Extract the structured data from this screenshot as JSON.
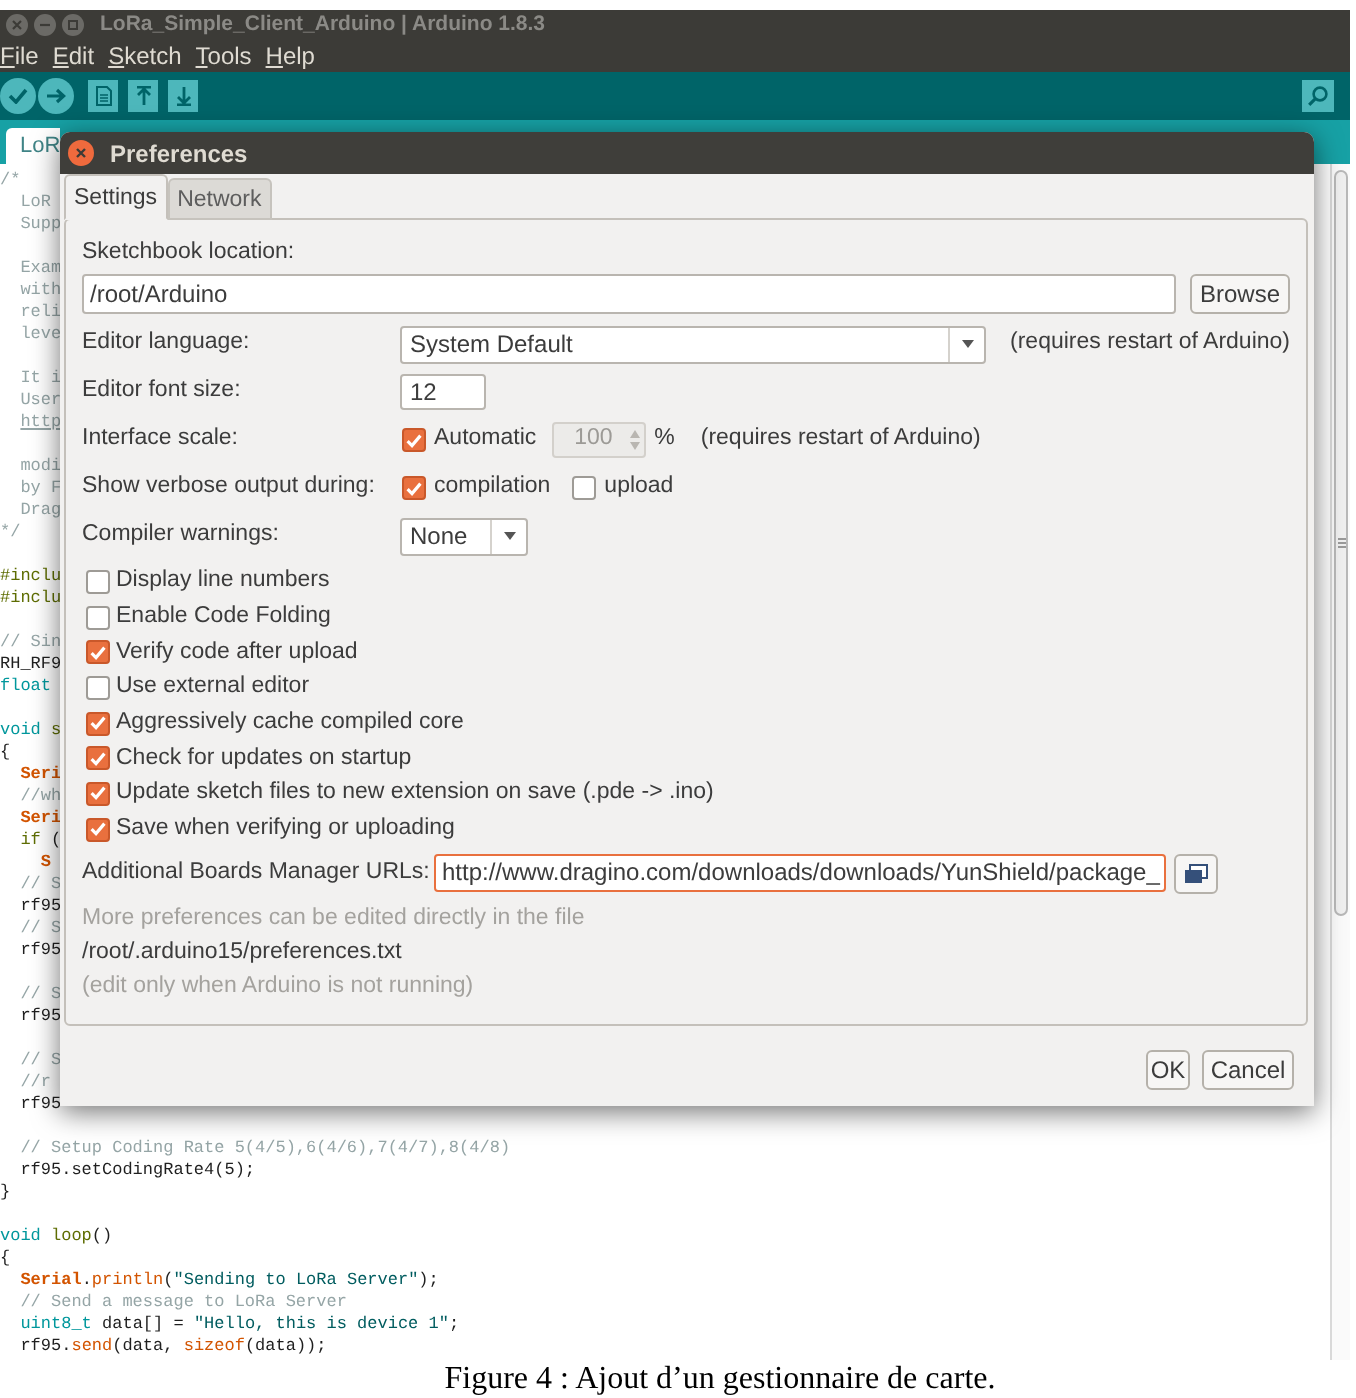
{
  "window": {
    "title": "LoRa_Simple_Client_Arduino | Arduino 1.8.3"
  },
  "menu": [
    "File",
    "Edit",
    "Sketch",
    "Tools",
    "Help"
  ],
  "editor_tabs": [
    {
      "label": "LoR",
      "selected": true
    }
  ],
  "code_lines": [
    {
      "parts": [
        {
          "text": "/*",
          "kind": "comment"
        }
      ]
    },
    {
      "parts": [
        {
          "text": "  LoR",
          "kind": "comment"
        }
      ]
    },
    {
      "parts": [
        {
          "text": "  Supp",
          "kind": "comment"
        }
      ]
    },
    {
      "blank_before": true,
      "parts": [
        {
          "text": "  Exam",
          "kind": "comment"
        }
      ]
    },
    {
      "parts": [
        {
          "text": "  with",
          "kind": "comment"
        }
      ]
    },
    {
      "parts": [
        {
          "text": "  reli",
          "kind": "comment"
        }
      ]
    },
    {
      "parts": [
        {
          "text": "  leve",
          "kind": "comment"
        }
      ]
    },
    {
      "blank_before": true,
      "parts": [
        {
          "text": "  It i",
          "kind": "comment"
        }
      ]
    },
    {
      "parts": [
        {
          "text": "  User",
          "kind": "comment"
        }
      ]
    },
    {
      "parts": [
        {
          "text": "  http",
          "kind": "link"
        }
      ]
    },
    {
      "blank_before": true,
      "parts": [
        {
          "text": "  modi",
          "kind": "comment"
        }
      ]
    },
    {
      "parts": [
        {
          "text": "  by F",
          "kind": "comment"
        }
      ]
    },
    {
      "parts": [
        {
          "text": "  Drag",
          "kind": "comment"
        }
      ]
    },
    {
      "parts": [
        {
          "text": "*/",
          "kind": "comment"
        }
      ]
    },
    {
      "blank_before": true,
      "parts": [
        {
          "text": "#inclu",
          "kind": "preprocessor"
        }
      ]
    },
    {
      "parts": [
        {
          "text": "#inclu",
          "kind": "preprocessor"
        }
      ]
    },
    {
      "blank_before": true,
      "parts": [
        {
          "text": "// Sin",
          "kind": "comment"
        }
      ]
    },
    {
      "parts": [
        {
          "text": "RH_RF9",
          "kind": "plain"
        }
      ]
    },
    {
      "parts": [
        {
          "text": "float",
          "kind": "type"
        }
      ]
    },
    {
      "blank_before": true,
      "parts": [
        {
          "text": "void",
          "kind": "type"
        },
        {
          "text": " s",
          "kind": "control"
        }
      ]
    },
    {
      "parts": [
        {
          "text": "{",
          "kind": "plain"
        }
      ]
    },
    {
      "parts": [
        {
          "text": "  Seri",
          "kind": "class"
        }
      ]
    },
    {
      "parts": [
        {
          "text": "  //wh",
          "kind": "comment"
        }
      ]
    },
    {
      "parts": [
        {
          "text": "  Seri",
          "kind": "class"
        }
      ]
    },
    {
      "parts": [
        {
          "text": "  if",
          "kind": "control"
        },
        {
          "text": " (",
          "kind": "plain"
        }
      ]
    },
    {
      "parts": [
        {
          "text": "    S",
          "kind": "class"
        }
      ]
    },
    {
      "parts": [
        {
          "text": "  // S",
          "kind": "comment"
        }
      ]
    },
    {
      "parts": [
        {
          "text": "  rf95",
          "kind": "plain"
        }
      ]
    },
    {
      "parts": [
        {
          "text": "  // S",
          "kind": "comment"
        }
      ]
    },
    {
      "parts": [
        {
          "text": "  rf95",
          "kind": "plain"
        }
      ]
    },
    {
      "blank_before": true,
      "parts": [
        {
          "text": "  // S",
          "kind": "comment"
        }
      ]
    },
    {
      "parts": [
        {
          "text": "  rf95",
          "kind": "plain"
        }
      ]
    },
    {
      "blank_before": true,
      "parts": [
        {
          "text": "  // S",
          "kind": "comment"
        }
      ]
    },
    {
      "parts": [
        {
          "text": "  //r",
          "kind": "comment"
        }
      ]
    },
    {
      "parts": [
        {
          "text": "  rf95",
          "kind": "plain"
        }
      ]
    },
    {
      "blank_before": true,
      "parts": [
        {
          "text": "  // Setup Coding Rate 5(4/5),6(4/6),7(4/7),8(4/8)",
          "kind": "comment"
        }
      ]
    },
    {
      "parts": [
        {
          "text": "  rf95.setCodingRate4(5);",
          "kind": "plain"
        }
      ]
    },
    {
      "parts": [
        {
          "text": "}",
          "kind": "plain"
        }
      ]
    },
    {
      "blank_before": true,
      "parts": [
        {
          "text": "void",
          "kind": "type"
        },
        {
          "text": " loop",
          "kind": "control"
        },
        {
          "text": "()",
          "kind": "plain"
        }
      ]
    },
    {
      "parts": [
        {
          "text": "{",
          "kind": "plain"
        }
      ]
    },
    {
      "parts": [
        {
          "text": "  Serial",
          "kind": "class"
        },
        {
          "text": ".",
          "kind": "plain"
        },
        {
          "text": "println",
          "kind": "function"
        },
        {
          "text": "(",
          "kind": "plain"
        },
        {
          "text": "\"Sending to LoRa Server\"",
          "kind": "string"
        },
        {
          "text": ");",
          "kind": "plain"
        }
      ]
    },
    {
      "parts": [
        {
          "text": "  // Send a message to LoRa Server",
          "kind": "comment"
        }
      ]
    },
    {
      "parts": [
        {
          "text": "  uint8_t",
          "kind": "type"
        },
        {
          "text": " data[] = ",
          "kind": "plain"
        },
        {
          "text": "\"Hello, this is device 1\"",
          "kind": "string"
        },
        {
          "text": ";",
          "kind": "plain"
        }
      ]
    },
    {
      "parts": [
        {
          "text": "  rf95.",
          "kind": "plain"
        },
        {
          "text": "send",
          "kind": "function"
        },
        {
          "text": "(data, ",
          "kind": "plain"
        },
        {
          "text": "sizeof",
          "kind": "function"
        },
        {
          "text": "(data));",
          "kind": "plain"
        }
      ]
    }
  ],
  "dialog": {
    "title": "Preferences",
    "tabs": [
      {
        "label": "Settings",
        "selected": true
      },
      {
        "label": "Network",
        "selected": false
      }
    ],
    "sketchbook": {
      "label": "Sketchbook location:",
      "value": "/root/Arduino",
      "button": "Browse"
    },
    "rows": [
      {
        "kind": "select",
        "label": "Editor language:",
        "value": "System Default",
        "note": "(requires restart of Arduino)"
      },
      {
        "kind": "text",
        "label": "Editor font size:",
        "value": "12"
      },
      {
        "kind": "scale",
        "label": "Interface scale:",
        "checkbox": {
          "label": "Automatic",
          "checked": true
        },
        "spinner": {
          "value": "100",
          "disabled": true
        },
        "unit": "%",
        "note": "(requires restart of Arduino)"
      },
      {
        "kind": "checks",
        "label": "Show verbose output during:",
        "options": [
          {
            "label": "compilation",
            "checked": true
          },
          {
            "label": "upload",
            "checked": false
          }
        ]
      },
      {
        "kind": "select",
        "label": "Compiler warnings:",
        "value": "None"
      }
    ],
    "options": [
      {
        "label": "Display line numbers",
        "checked": false
      },
      {
        "label": "Enable Code Folding",
        "checked": false
      },
      {
        "label": "Verify code after upload",
        "checked": true
      },
      {
        "label": "Use external editor",
        "checked": false
      },
      {
        "label": "Aggressively cache compiled core",
        "checked": true
      },
      {
        "label": "Check for updates on startup",
        "checked": true
      },
      {
        "label": "Update sketch files to new extension on save (.pde -> .ino)",
        "checked": true
      },
      {
        "label": "Save when verifying or uploading",
        "checked": true
      }
    ],
    "boards_urls": {
      "label": "Additional Boards Manager URLs:",
      "value": "http://www.dragino.com/downloads/downloads/YunShield/package_",
      "focused": true
    },
    "notes": [
      {
        "kind": "hint",
        "text": "More preferences can be edited directly in the file"
      },
      {
        "kind": "path",
        "text": "/root/.arduino15/preferences.txt"
      },
      {
        "kind": "hint",
        "text": "(edit only when Arduino is not running)"
      }
    ],
    "buttons": [
      {
        "kind": "ok",
        "label": "OK"
      },
      {
        "kind": "cancel",
        "label": "Cancel"
      }
    ]
  },
  "caption": "Figure 4 : Ajout d’un gestionnaire de carte."
}
